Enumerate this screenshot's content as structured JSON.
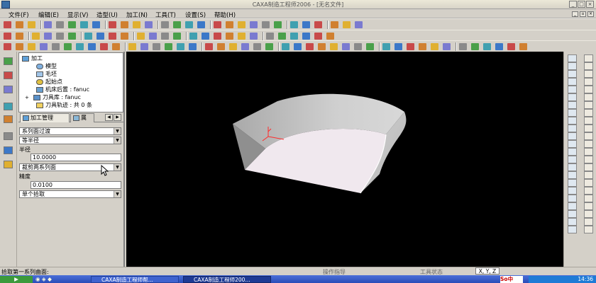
{
  "window": {
    "title": "CAXA制造工程师2006 - [无名文件]"
  },
  "menu": {
    "items": [
      "文件(F)",
      "编辑(E)",
      "显示(V)",
      "造型(U)",
      "加工(N)",
      "工具(T)",
      "设置(S)",
      "帮助(H)"
    ]
  },
  "tree": {
    "items": [
      {
        "label": "加工",
        "level": 0
      },
      {
        "label": "模型",
        "level": 1
      },
      {
        "label": "毛坯",
        "level": 1
      },
      {
        "label": "起始点",
        "level": 1
      },
      {
        "label": "机床后置 : fanuc",
        "level": 1
      },
      {
        "label": "刀具库 : fanuc",
        "level": 1
      },
      {
        "label": "刀具轨迹 : 共 0 条",
        "level": 1
      }
    ]
  },
  "panel_tabs": {
    "machining": "加工管理",
    "second": "属"
  },
  "form": {
    "surface_type": "系列面过渡",
    "radius_type": "等半径",
    "radius_label": "半径",
    "radius_value": "10.0000",
    "cut_mode": "裁剪两系列面",
    "precision_label": "精度",
    "precision_value": "0.0100",
    "pick_mode": "单个拾取"
  },
  "status": {
    "prompt": "拾取第一系列曲面:",
    "command": "操作指导",
    "tool_state": "工具状态",
    "coords": "X, Y, Z"
  },
  "taskbar": {
    "task1": "CAXA制造工程师帮...",
    "task2": "CAXA制造工程师200...",
    "clock": "14:36",
    "ime": "中"
  },
  "colors": {
    "viewport": "#000000",
    "surface": "#c8c8c8",
    "floor": "#f0e8ee",
    "edge": "#ffffff",
    "axis_red": "#ff2a2a",
    "taskbar": "#2a4cb8"
  }
}
